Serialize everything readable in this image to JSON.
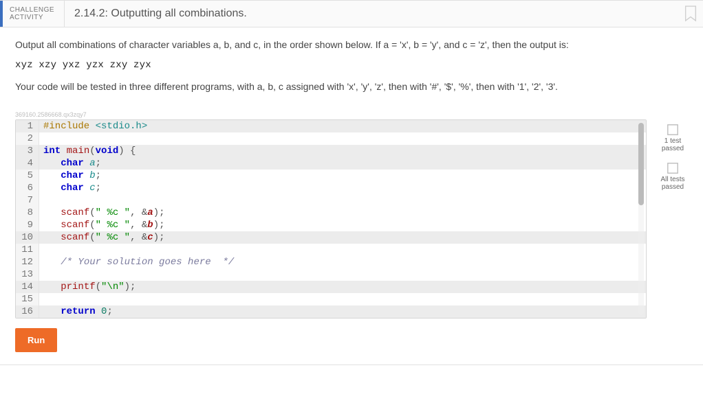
{
  "header": {
    "kind_line1": "CHALLENGE",
    "kind_line2": "ACTIVITY",
    "title": "2.14.2: Outputting all combinations."
  },
  "prompt": {
    "p1": "Output all combinations of character variables a, b, and c, in the order shown below. If a = 'x', b = 'y', and c = 'z', then the output is:",
    "sample": "xyz xzy yxz yzx zxy zyx",
    "p2": "Your code will be tested in three different programs, with a, b, c assigned with 'x', 'y', 'z', then with '#', '$', '%', then with '1', '2', '3'."
  },
  "sentinel": "369160.2586668.qx3zqy7",
  "code": {
    "lines": [
      {
        "n": 1,
        "hl": true,
        "kind": "preproc",
        "raw": "#include <stdio.h>"
      },
      {
        "n": 2,
        "hl": false,
        "kind": "blank",
        "raw": ""
      },
      {
        "n": 3,
        "hl": true,
        "kind": "sig",
        "raw": "int main(void) {"
      },
      {
        "n": 4,
        "hl": true,
        "kind": "decl",
        "ident": "a"
      },
      {
        "n": 5,
        "hl": false,
        "kind": "decl",
        "ident": "b"
      },
      {
        "n": 6,
        "hl": false,
        "kind": "decl",
        "ident": "c"
      },
      {
        "n": 7,
        "hl": false,
        "kind": "blank",
        "raw": ""
      },
      {
        "n": 8,
        "hl": false,
        "kind": "scanf",
        "ident": "a"
      },
      {
        "n": 9,
        "hl": false,
        "kind": "scanf",
        "ident": "b"
      },
      {
        "n": 10,
        "hl": true,
        "kind": "scanf",
        "ident": "c"
      },
      {
        "n": 11,
        "hl": false,
        "kind": "blank",
        "raw": ""
      },
      {
        "n": 12,
        "hl": false,
        "kind": "comment",
        "raw": "/* Your solution goes here  */"
      },
      {
        "n": 13,
        "hl": false,
        "kind": "blank",
        "raw": ""
      },
      {
        "n": 14,
        "hl": true,
        "kind": "printf",
        "raw": "printf(\"\\n\");"
      },
      {
        "n": 15,
        "hl": false,
        "kind": "blank",
        "raw": ""
      },
      {
        "n": 16,
        "hl": true,
        "kind": "return",
        "raw": "return 0;"
      }
    ]
  },
  "status": {
    "items": [
      {
        "label1": "1 test",
        "label2": "passed"
      },
      {
        "label1": "All tests",
        "label2": "passed"
      }
    ]
  },
  "buttons": {
    "run": "Run"
  }
}
